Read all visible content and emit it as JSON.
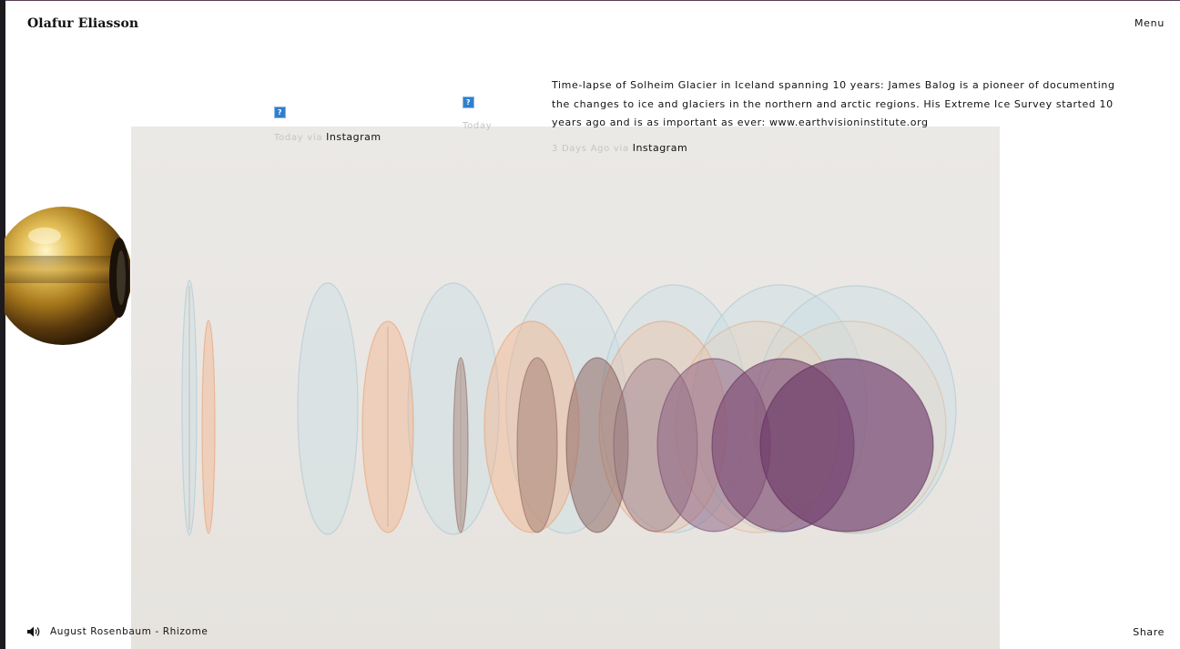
{
  "header": {
    "logo": "Olafur Eliasson",
    "menu_label": "Menu"
  },
  "posts": [
    {
      "image": "broken-image-icon",
      "time": "Today",
      "via": "via",
      "source": "Instagram"
    },
    {
      "image": "broken-image-icon",
      "time": "Today"
    },
    {
      "text": "Time-lapse of Solheim Glacier in Iceland spanning 10 years: James Balog is a pioneer of documenting the changes to ice and glaciers in the northern and arctic regions. His Extreme Ice Survey started 10 years ago and is as important as ever: www.earthvisioninstitute.org",
      "time": "3 Days Ago",
      "via": "via",
      "source": "Instagram"
    }
  ],
  "artwork": {
    "description_icon": "watercolour-ellipses",
    "colors": {
      "blue": "#c7dbe3",
      "orange": "#f3b58e",
      "brown": "#a07a6a",
      "purple": "#6e3a6a"
    }
  },
  "player": {
    "icon": "speaker-icon",
    "track": "August Rosenbaum - Rhizome"
  },
  "footer": {
    "share_label": "Share"
  },
  "colors": {
    "text": "#111111",
    "meta": "#c5c5c5",
    "link_icon": "#2f7fce"
  }
}
